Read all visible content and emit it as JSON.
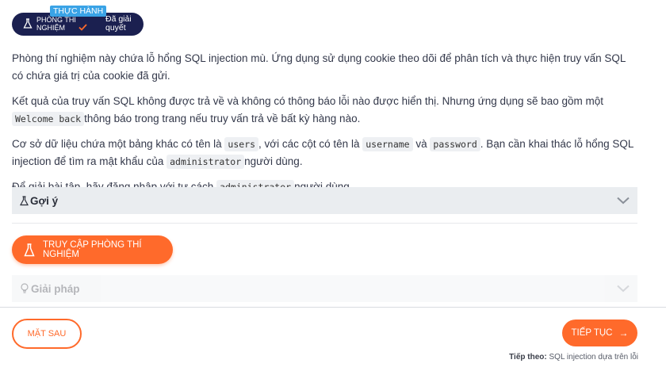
{
  "badge": {
    "tag": "THỰC HÀNH",
    "left_label": "PHÒNG THÍ NGHIỆM",
    "right_label": "Đã giải quyết"
  },
  "content": {
    "p1": "Phòng thí nghiệm này chứa lỗ hổng SQL injection mù. Ứng dụng sử dụng cookie theo dõi để phân tích và thực hiện truy vấn SQL có chứa giá trị của cookie đã gửi.",
    "p2_a": "Kết quả của truy vấn SQL không được trả về và không có thông báo lỗi nào được hiển thị. Nhưng ứng dụng sẽ bao gồm một ",
    "p2_code": "Welcome back",
    "p2_b": "thông báo trong trang nếu truy vấn trả về bất kỳ hàng nào.",
    "p3_a": "Cơ sở dữ liệu chứa một bảng khác có tên là ",
    "p3_code1": "users",
    "p3_b": ", với các cột có tên là ",
    "p3_code2": "username",
    "p3_c": "và ",
    "p3_code3": "password",
    "p3_d": ". Bạn cần khai thác lỗ hổng SQL injection để tìm ra mật khẩu của ",
    "p3_code4": "administrator",
    "p3_e": "người dùng.",
    "p4_a": "Để giải bài tập, hãy đăng nhập với tư cách ",
    "p4_code": "administrator",
    "p4_b": "người dùng."
  },
  "hint": {
    "label": "Gợi ý"
  },
  "lab_button": {
    "label": "TRUY CẬP PHÒNG THÍ NGHIỆM"
  },
  "solution": {
    "label": "Giải pháp"
  },
  "footer": {
    "back_label": "MẶT SAU",
    "next_label": "TIẾP TỤC",
    "next_prefix": "Tiếp theo:",
    "next_title": "SQL injection dựa trên lỗi"
  },
  "colors": {
    "accent": "#ff6a2b",
    "navy": "#1b2050",
    "tag_blue": "#3aa3e6"
  }
}
